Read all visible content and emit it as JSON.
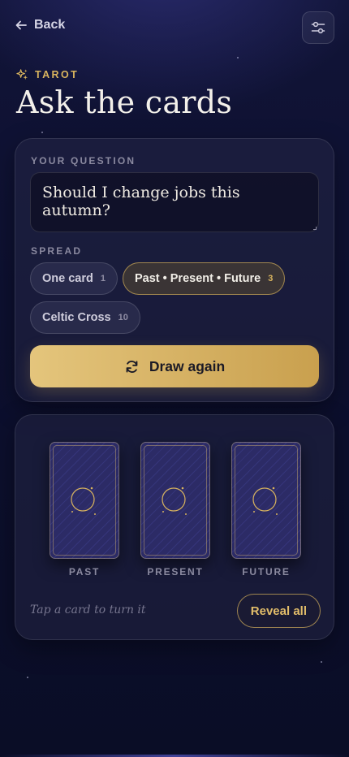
{
  "nav": {
    "back_label": "Back",
    "filter_icon": "sliders-icon"
  },
  "header": {
    "eyebrow": "TAROT",
    "title": "Ask the cards"
  },
  "question": {
    "label": "YOUR QUESTION",
    "value": "Should I change jobs this autumn?"
  },
  "spread": {
    "label": "SPREAD",
    "options": [
      {
        "label": "One card",
        "count": "1",
        "selected": false
      },
      {
        "label": "Past • Present • Future",
        "count": "3",
        "selected": true
      },
      {
        "label": "Celtic Cross",
        "count": "10",
        "selected": false
      }
    ]
  },
  "draw_button": {
    "label": "Draw again",
    "icon": "refresh-icon"
  },
  "reading": {
    "cards": [
      {
        "position": "PAST",
        "face": "down"
      },
      {
        "position": "PRESENT",
        "face": "down"
      },
      {
        "position": "FUTURE",
        "face": "down"
      }
    ],
    "hint": "Tap a card to turn it",
    "reveal_label": "Reveal all"
  },
  "colors": {
    "accent_gold": "#d9b45e",
    "background": "#0d1030",
    "card_back": "#2c2b66"
  }
}
